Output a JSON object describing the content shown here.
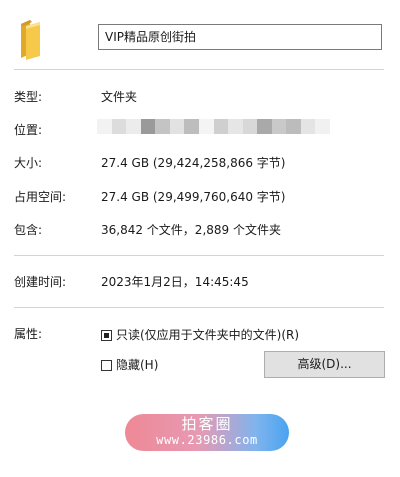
{
  "folder": {
    "icon": "folder-icon",
    "name": "VIP精品原创街拍"
  },
  "general": {
    "type_label": "类型:",
    "type_value": "文件夹",
    "location_label": "位置:",
    "location_blurred": true,
    "size_label": "大小:",
    "size_value": "27.4 GB (29,424,258,866 字节)",
    "size_on_disk_label": "占用空间:",
    "size_on_disk_value": "27.4 GB (29,499,760,640 字节)",
    "contains_label": "包含:",
    "contains_value": "36,842 个文件，2,889 个文件夹",
    "created_label": "创建时间:",
    "created_value": "2023年1月2日，14:45:45"
  },
  "attributes": {
    "label": "属性:",
    "readonly_label": "只读(仅应用于文件夹中的文件)(R)",
    "readonly_state": "indeterminate",
    "hidden_label": "隐藏(H)",
    "hidden_checked": false,
    "advanced_button": "高级(D)..."
  },
  "watermark": {
    "title": "拍客圈",
    "url": "www.23986.com"
  },
  "colors": {
    "divider": "#d4d4d4",
    "button_bg": "#e1e1e1",
    "folder_yellow": "#f6c94a",
    "watermark_pink": "#ef8896",
    "watermark_blue": "#4aa3f0"
  }
}
